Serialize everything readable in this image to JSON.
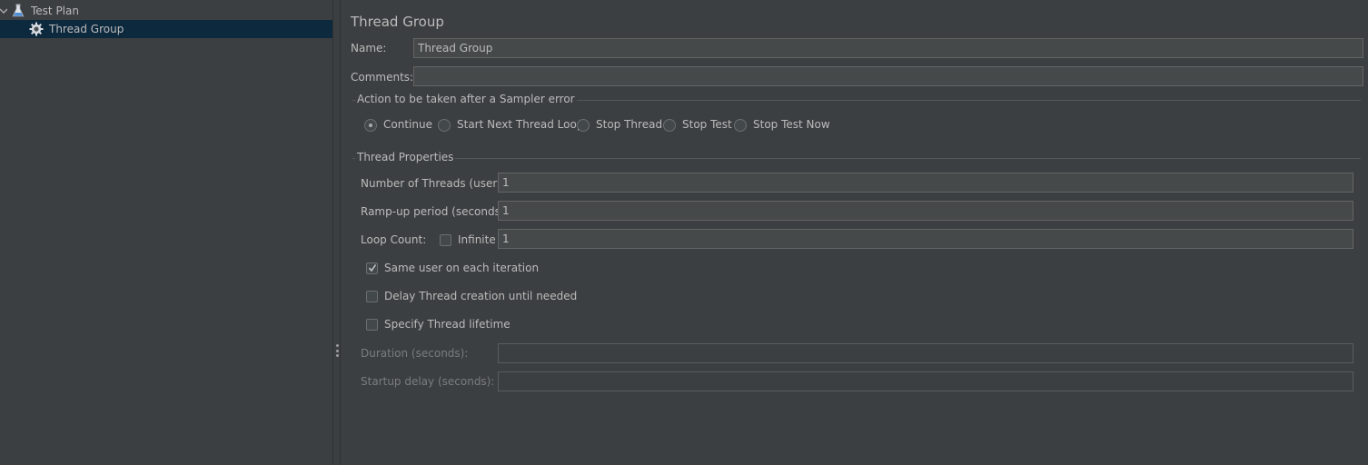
{
  "tree": {
    "items": [
      {
        "label": "Test Plan",
        "icon": "flask-icon",
        "expanded": true,
        "selected": false
      },
      {
        "label": "Thread Group",
        "icon": "gear-icon",
        "selected": true
      }
    ]
  },
  "panel": {
    "title": "Thread Group",
    "name_label": "Name:",
    "name_value": "Thread Group",
    "comments_label": "Comments:",
    "comments_value": "",
    "action_section": {
      "title": "Action to be taken after a Sampler error",
      "options": [
        {
          "label": "Continue",
          "selected": true
        },
        {
          "label": "Start Next Thread Loop",
          "selected": false
        },
        {
          "label": "Stop Thread",
          "selected": false
        },
        {
          "label": "Stop Test",
          "selected": false
        },
        {
          "label": "Stop Test Now",
          "selected": false
        }
      ]
    },
    "thread_props": {
      "title": "Thread Properties",
      "threads_label": "Number of Threads (users):",
      "threads_value": "1",
      "rampup_label": "Ramp-up period (seconds):",
      "rampup_value": "1",
      "loop_label": "Loop Count:",
      "infinite_label": "Infinite",
      "infinite_checked": false,
      "loop_value": "1",
      "same_user_label": "Same user on each iteration",
      "same_user_checked": true,
      "delay_label": "Delay Thread creation until needed",
      "delay_checked": false,
      "lifetime_label": "Specify Thread lifetime",
      "lifetime_checked": false,
      "duration_label": "Duration (seconds):",
      "duration_value": "",
      "startup_label": "Startup delay (seconds):",
      "startup_value": ""
    }
  },
  "colors": {
    "background": "#3c3f41",
    "selection": "#0d293e",
    "field_bg": "#45494a",
    "text": "#bbbbbb"
  }
}
